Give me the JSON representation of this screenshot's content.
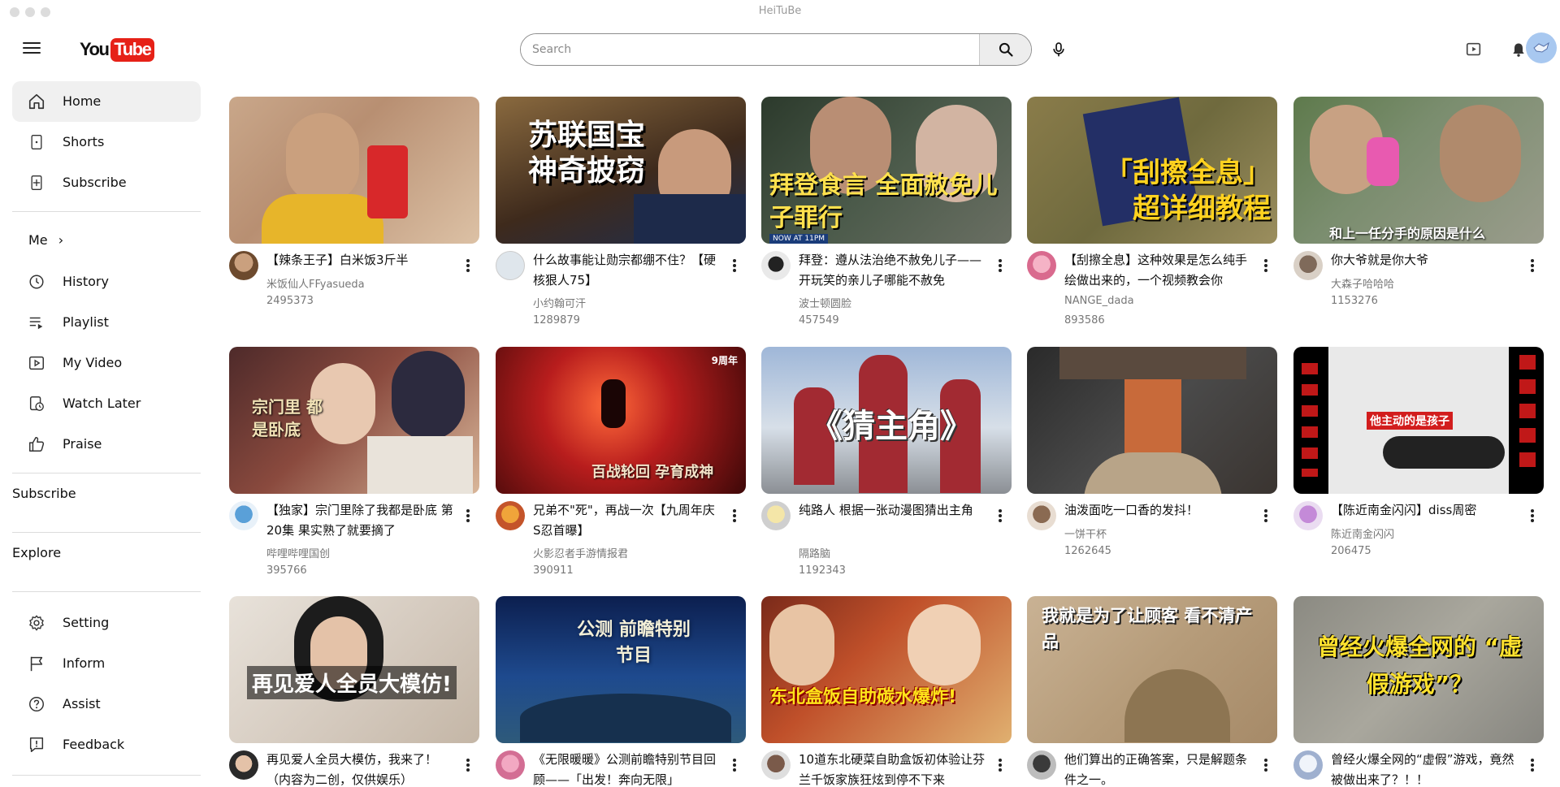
{
  "window": {
    "title": "HeiTuBe"
  },
  "header": {
    "logo_you": "You",
    "logo_tube": "Tube",
    "search_placeholder": "Search"
  },
  "sidebar": {
    "primary": [
      {
        "label": "Home",
        "icon": "home-icon"
      },
      {
        "label": "Shorts",
        "icon": "shorts-icon"
      },
      {
        "label": "Subscribe",
        "icon": "subscriptions-icon"
      }
    ],
    "me_label": "Me",
    "me_arrow": "›",
    "me_items": [
      {
        "label": "History",
        "icon": "history-icon"
      },
      {
        "label": "Playlist",
        "icon": "playlist-icon"
      },
      {
        "label": "My Video",
        "icon": "my-video-icon"
      },
      {
        "label": "Watch Later",
        "icon": "watch-later-icon"
      },
      {
        "label": "Praise",
        "icon": "thumbs-up-icon"
      }
    ],
    "subscribe_label": "Subscribe",
    "explore_label": "Explore",
    "footer_items": [
      {
        "label": "Setting",
        "icon": "gear-icon"
      },
      {
        "label": "Inform",
        "icon": "flag-icon"
      },
      {
        "label": "Assist",
        "icon": "help-icon"
      },
      {
        "label": "Feedback",
        "icon": "feedback-icon"
      }
    ]
  },
  "videos": [
    {
      "title": "【辣条王子】白米饭3斤半",
      "channel": "米饭仙人FFyasueda",
      "views": "2495373"
    },
    {
      "title": "什么故事能让勋宗都绷不住？【硬核狠人75】",
      "channel": "小约翰可汗",
      "views": "1289879",
      "thumb_text": "苏联国宝 神奇披窃"
    },
    {
      "title": "拜登：遵从法治绝不赦免儿子——开玩笑的亲儿子哪能不赦免",
      "channel": "波士顿圆脸",
      "views": "457549",
      "thumb_text": "拜登食言 全面赦免儿子罪行",
      "thumb_badge": "NOW AT 11PM"
    },
    {
      "title": "【刮擦全息】这种效果是怎么纯手绘做出来的，一个视频教会你",
      "channel": "NANGE_dada",
      "views": "893586",
      "thumb_text": "「刮擦全息」 超详细教程"
    },
    {
      "title": "你大爷就是你大爷",
      "channel": "大森子哈哈哈",
      "views": "1153276",
      "thumb_text": "和上一任分手的原因是什么"
    },
    {
      "title": "【独家】宗门里除了我都是卧底 第20集 果实熟了就要摘了",
      "channel": "哔哩哔哩国创",
      "views": "395766",
      "thumb_text": "宗门里 都是卧底"
    },
    {
      "title": "兄弟不\"死\"，再战一次【九周年庆S忍首曝】",
      "channel": "火影忍者手游情报君",
      "views": "390911",
      "thumb_text": "百战轮回 孕育成神",
      "thumb_badge": "9周年"
    },
    {
      "title": "纯路人 根据一张动漫图猜出主角",
      "channel": "隔路脑",
      "views": "1192343",
      "thumb_text": "《猜主角》"
    },
    {
      "title": "油泼面吃一口香的发抖！",
      "channel": "一饼干杯",
      "views": "1262645"
    },
    {
      "title": "【陈近南金闪闪】diss周密",
      "channel": "陈近南金闪闪",
      "views": "206475",
      "thumb_text": "他主动的是孩子"
    },
    {
      "title": "再见爱人全员大模仿，我来了！（内容为二创，仅供娱乐）",
      "channel": "",
      "views": "",
      "thumb_text": "再见爱人全员大模仿!"
    },
    {
      "title": "《无限暖暖》公测前瞻特别节目回顾——「出发！奔向无限」",
      "channel": "",
      "views": "",
      "thumb_text": "公测 前瞻特别节目"
    },
    {
      "title": "10道东北硬菜自助盒饭初体验让芬兰千饭家族狂炫到停不下来",
      "channel": "",
      "views": "",
      "thumb_text": "东北盒饭自助碳水爆炸!"
    },
    {
      "title": "他们算出的正确答案，只是解题条件之一。",
      "channel": "",
      "views": "",
      "thumb_text": "我就是为了让顾客 看不清产品"
    },
    {
      "title": "曾经火爆全网的“虚假”游戏，竟然被做出来了？！！",
      "channel": "",
      "views": "",
      "thumb_text": "曾经火爆全网的 “虚假游戏”？"
    }
  ]
}
